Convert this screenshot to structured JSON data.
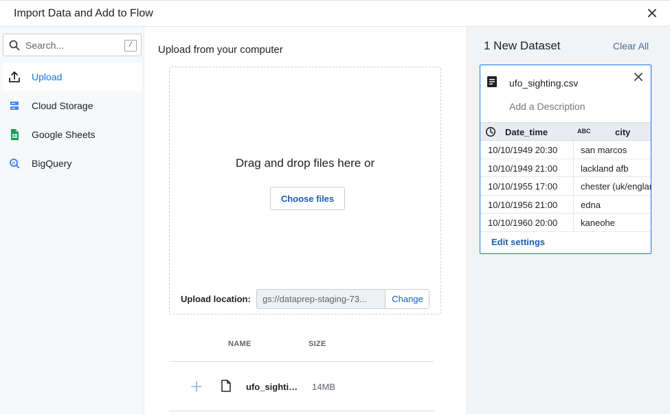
{
  "window": {
    "title": "Import Data and Add to Flow"
  },
  "sidebar": {
    "search": {
      "placeholder": "Search...",
      "shortcut": "/"
    },
    "items": [
      {
        "label": "Upload",
        "icon": "upload-icon",
        "active": true
      },
      {
        "label": "Cloud Storage",
        "icon": "cloud-storage-icon",
        "active": false
      },
      {
        "label": "Google Sheets",
        "icon": "google-sheets-icon",
        "active": false
      },
      {
        "label": "BigQuery",
        "icon": "bigquery-icon",
        "active": false
      }
    ]
  },
  "main": {
    "heading": "Upload from your computer",
    "dropzone_text": "Drag and drop files here or",
    "choose_label": "Choose files",
    "upload_location_label": "Upload location:",
    "upload_location_path": "gs://dataprep-staging-73...",
    "change_label": "Change",
    "files_table": {
      "columns": {
        "name": "NAME",
        "size": "SIZE"
      },
      "rows": [
        {
          "name": "ufo_sightin...",
          "size": "14MB"
        }
      ]
    }
  },
  "right_panel": {
    "title": "1 New Dataset",
    "clear_label": "Clear All",
    "dataset": {
      "filename": "ufo_sighting.csv",
      "description_placeholder": "Add a Description",
      "columns": [
        {
          "name": "Date_time",
          "type_icon": "clock-icon"
        },
        {
          "name": "city",
          "type_icon": "string-type-icon",
          "type_glyph": "ABC"
        }
      ],
      "rows": [
        [
          "10/10/1949 20:30",
          "san marcos"
        ],
        [
          "10/10/1949 21:00",
          "lackland afb"
        ],
        [
          "10/10/1955 17:00",
          "chester (uk/england)"
        ],
        [
          "10/10/1956 21:00",
          "edna"
        ],
        [
          "10/10/1960 20:00",
          "kaneohe"
        ]
      ],
      "edit_label": "Edit settings"
    }
  },
  "colors": {
    "accent": "#1a73e8",
    "link": "#1a5fb4",
    "sidebar_bg": "#f7f8f9",
    "panel_bg": "#f1f3f5"
  }
}
